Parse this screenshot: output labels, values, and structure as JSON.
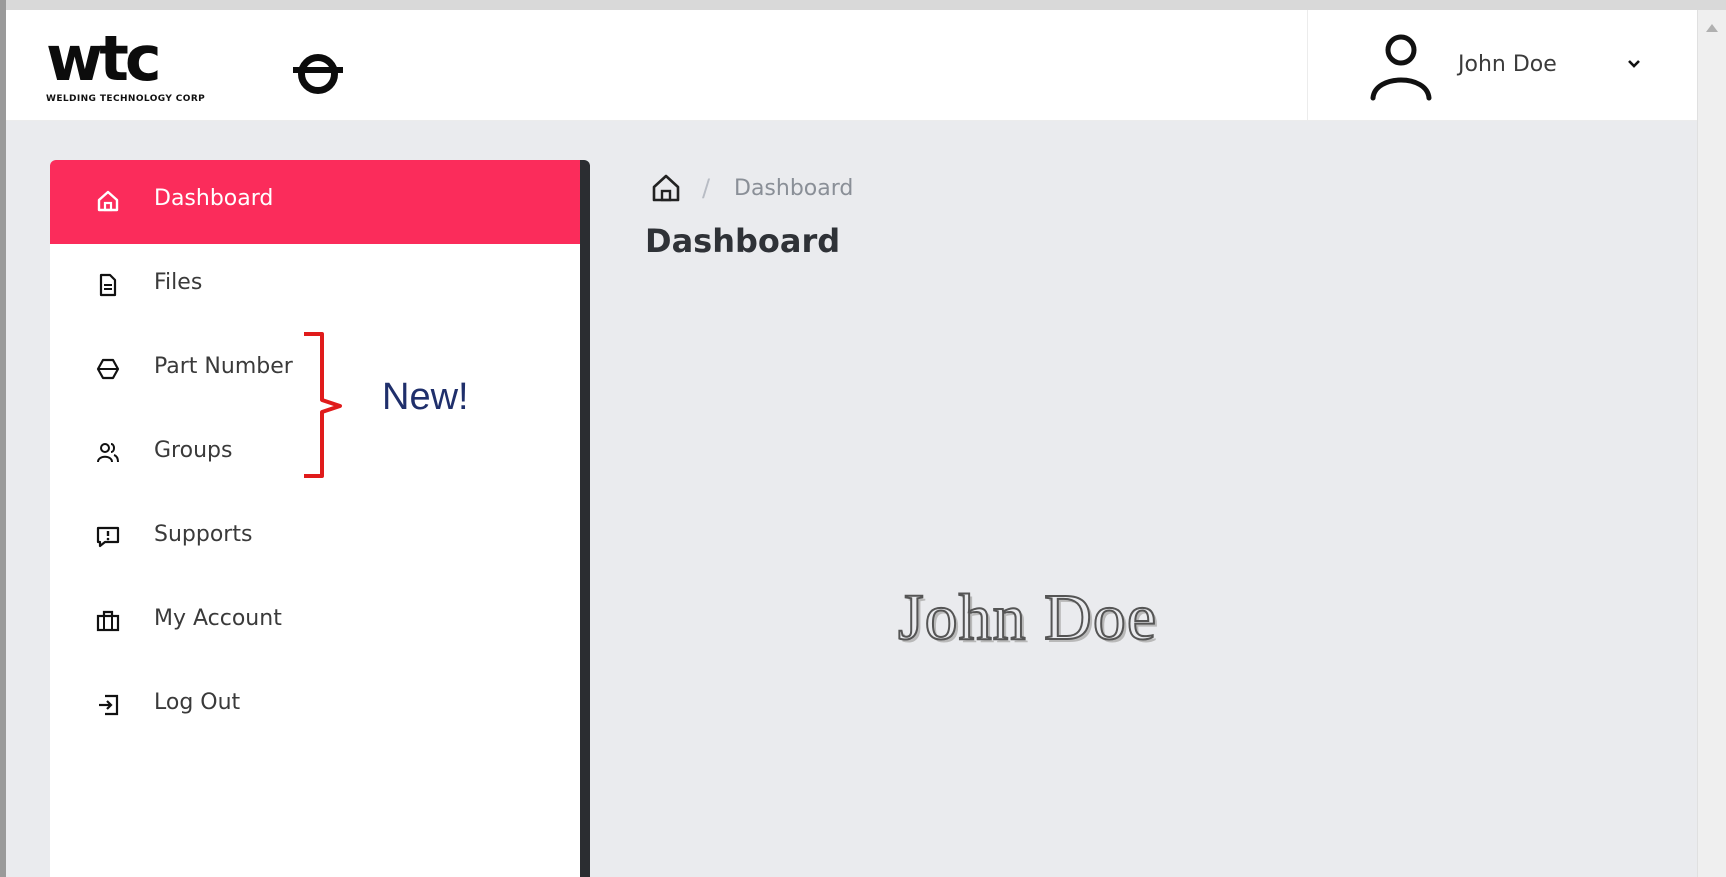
{
  "header": {
    "logo_text": "wtc",
    "logo_subtitle": "WELDING TECHNOLOGY CORP",
    "user_name": "John Doe"
  },
  "sidebar": {
    "items": [
      {
        "label": "Dashboard",
        "icon": "home-icon",
        "active": true
      },
      {
        "label": "Files",
        "icon": "file-icon",
        "active": false
      },
      {
        "label": "Part Number",
        "icon": "hexagon-icon",
        "active": false
      },
      {
        "label": "Groups",
        "icon": "users-icon",
        "active": false
      },
      {
        "label": "Supports",
        "icon": "message-alert-icon",
        "active": false
      },
      {
        "label": "My Account",
        "icon": "briefcase-icon",
        "active": false
      },
      {
        "label": "Log Out",
        "icon": "logout-icon",
        "active": false
      }
    ]
  },
  "annotation": {
    "text": "New!",
    "color": "#e01b1b"
  },
  "breadcrumb": {
    "separator": "/",
    "current": "Dashboard"
  },
  "main": {
    "title": "Dashboard",
    "signature": "John Doe"
  },
  "colors": {
    "accent": "#fb2c5b",
    "background": "#eaebee",
    "sidebar_border": "#2b2d31"
  }
}
